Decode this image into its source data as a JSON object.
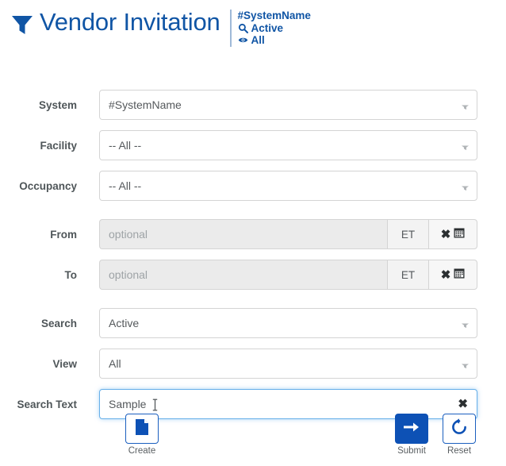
{
  "header": {
    "filter_icon": "funnel-icon",
    "title": "Vendor Invitation",
    "meta": [
      {
        "icon": "",
        "label": "#SystemName"
      },
      {
        "icon": "search-icon",
        "label": "Active"
      },
      {
        "icon": "eye-icon",
        "label": "All"
      }
    ]
  },
  "form": {
    "rows": [
      {
        "label": "System",
        "type": "select",
        "value": "#SystemName"
      },
      {
        "label": "Facility",
        "type": "select",
        "value": "-- All --"
      },
      {
        "label": "Occupancy",
        "type": "select",
        "value": "-- All --"
      },
      {
        "label": "From",
        "type": "date",
        "value": "",
        "placeholder": "optional",
        "addon": "ET"
      },
      {
        "label": "To",
        "type": "date",
        "value": "",
        "placeholder": "optional",
        "addon": "ET"
      },
      {
        "label": "Search",
        "type": "select",
        "value": "Active"
      },
      {
        "label": "View",
        "type": "select",
        "value": "All"
      },
      {
        "label": "Search Text",
        "type": "text",
        "value": "Sample",
        "focused": true
      }
    ],
    "clear_glyph": "✖"
  },
  "actions": {
    "create": {
      "label": "Create",
      "icon": "document-icon"
    },
    "submit": {
      "label": "Submit",
      "icon": "arrow-right-icon"
    },
    "reset": {
      "label": "Reset",
      "icon": "refresh-icon"
    }
  },
  "colors": {
    "brand_blue": "#1055a5",
    "button_blue": "#0d51b5",
    "label_grey": "#4f5659",
    "value_grey": "#55595c",
    "border_grey": "#d4d4d4",
    "disabled_bg": "#ebebeb",
    "focus_blue": "#66afe9"
  }
}
